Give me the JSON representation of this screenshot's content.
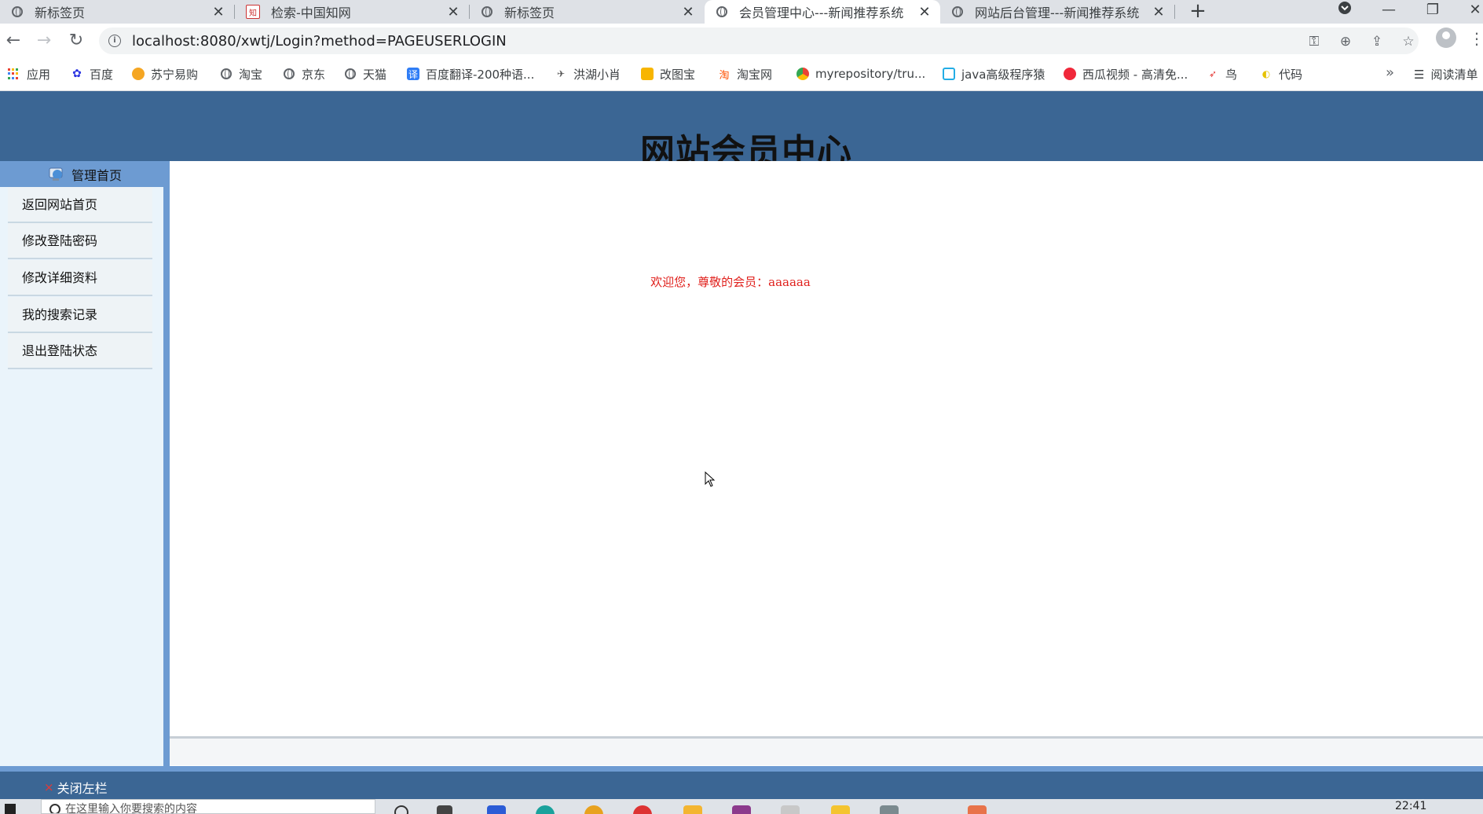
{
  "browser": {
    "tabs": [
      {
        "title": "新标签页",
        "icon": "chrome-icon",
        "active": false
      },
      {
        "title": "检索-中国知网",
        "icon": "cnki-icon",
        "active": false
      },
      {
        "title": "新标签页",
        "icon": "chrome-icon",
        "active": false
      },
      {
        "title": "会员管理中心---新闻推荐系统",
        "icon": "globe-icon",
        "active": true
      },
      {
        "title": "网站后台管理---新闻推荐系统",
        "icon": "globe-icon",
        "active": false
      }
    ],
    "close_glyph": "✕",
    "new_tab_glyph": "+",
    "url": "localhost:8080/xwtj/Login?method=PAGEUSERLOGIN",
    "bookmarks": [
      {
        "label": "应用",
        "icon": "apps-grid-icon"
      },
      {
        "label": "百度",
        "icon": "baidu-paw-icon"
      },
      {
        "label": "苏宁易购",
        "icon": "suning-icon"
      },
      {
        "label": "淘宝",
        "icon": "globe-icon"
      },
      {
        "label": "京东",
        "icon": "globe-icon"
      },
      {
        "label": "天猫",
        "icon": "globe-icon"
      },
      {
        "label": "百度翻译-200种语...",
        "icon": "fanyi-icon"
      },
      {
        "label": "洪湖小肖",
        "icon": "bird-icon"
      },
      {
        "label": "改图宝",
        "icon": "gaitubao-icon"
      },
      {
        "label": "淘宝网",
        "icon": "taobao-icon"
      },
      {
        "label": "myrepository/tru...",
        "icon": "chrome-icon"
      },
      {
        "label": "java高级程序猿",
        "icon": "bilibili-icon"
      },
      {
        "label": "西瓜视频 - 高清免...",
        "icon": "xigua-icon"
      },
      {
        "label": "鸟",
        "icon": "bird-icon"
      },
      {
        "label": "代码",
        "icon": "moon-icon"
      }
    ],
    "more_bookmarks": "»",
    "reading_list": "阅读清单"
  },
  "page": {
    "title": "网站会员中心",
    "left_head": "管理首页",
    "menu": [
      "返回网站首页",
      "修改登陆密码",
      "修改详细资料",
      "我的搜索记录",
      "退出登陆状态"
    ],
    "welcome": "欢迎您，尊敬的会员：aaaaaa",
    "close_left_x": "×",
    "close_left_label": "关闭左栏"
  },
  "taskbar": {
    "search_placeholder": "在这里输入你要搜索的内容",
    "time": "22:41"
  },
  "colors": {
    "header_blue": "#3b6694",
    "frame_blue": "#6d9bd2",
    "welcome_red": "#e0201c"
  }
}
